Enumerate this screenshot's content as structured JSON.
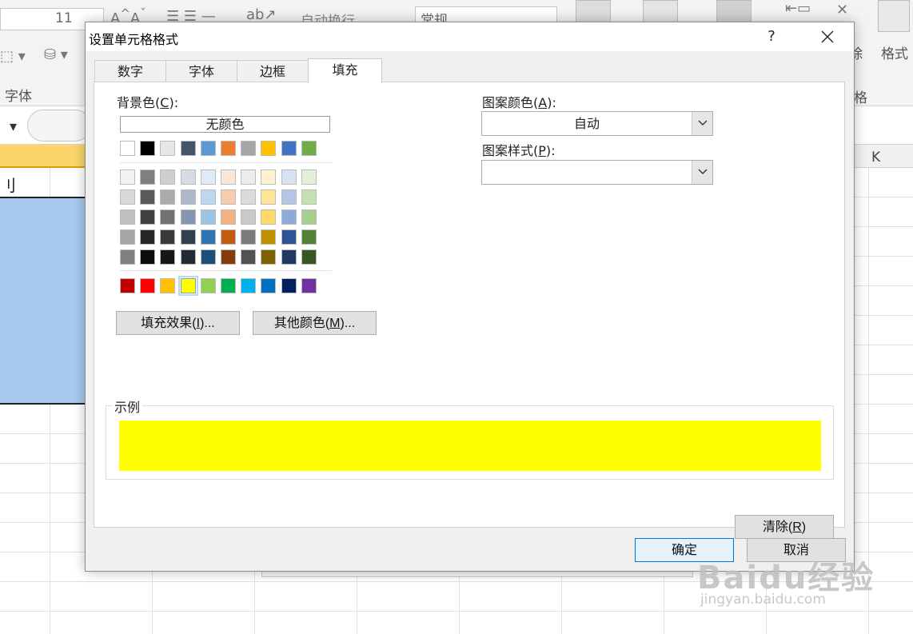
{
  "excel_bg": {
    "font_size": "11",
    "auto_wrap": "自动换行",
    "number_format": "常规",
    "font_group": "字体",
    "cells_group_partial": "格",
    "delete_partial": "除",
    "format": "格式",
    "column_k": "K",
    "row_text": "刂"
  },
  "dialog": {
    "title": "设置单元格格式",
    "help": "?",
    "close": "✕",
    "tabs": [
      {
        "label": "数字"
      },
      {
        "label": "字体"
      },
      {
        "label": "边框"
      },
      {
        "label": "填充",
        "active": true
      }
    ],
    "background_color": {
      "label": "背景色",
      "hotkey": "C",
      "suffix": ":",
      "no_color": "无颜色"
    },
    "top_row": [
      "#ffffff",
      "#000000",
      "#e7e6e6",
      "#44546a",
      "#5b9bd5",
      "#ed7d31",
      "#a5a5a5",
      "#ffc000",
      "#4472c4",
      "#70ad47"
    ],
    "shade_rows": [
      [
        "#f2f2f2",
        "#7f7f7f",
        "#d0cece",
        "#d6dce4",
        "#deebf6",
        "#fbe5d5",
        "#ededed",
        "#fff2cc",
        "#d9e2f3",
        "#e2efd9"
      ],
      [
        "#d8d8d8",
        "#595959",
        "#aeaaaa",
        "#adb9ca",
        "#bdd7ee",
        "#f7cbac",
        "#dbdbdb",
        "#fee599",
        "#b4c6e7",
        "#c5e0b3"
      ],
      [
        "#bfbfbf",
        "#3f3f3f",
        "#757070",
        "#8496b0",
        "#9dc3e6",
        "#f4b183",
        "#c9c9c9",
        "#ffd966",
        "#8eaadb",
        "#a8d08d"
      ],
      [
        "#a5a5a5",
        "#262626",
        "#3a3838",
        "#323f4f",
        "#2e75b5",
        "#c55a11",
        "#7b7b7b",
        "#bf9000",
        "#2f5496",
        "#538135"
      ],
      [
        "#7f7f7f",
        "#0c0c0c",
        "#171616",
        "#222a35",
        "#1e4e79",
        "#843c0b",
        "#525252",
        "#7f6000",
        "#1f3864",
        "#375623"
      ]
    ],
    "standard_row": [
      "#c00000",
      "#ff0000",
      "#ffc000",
      "#ffff00",
      "#92d050",
      "#00b050",
      "#00b0f0",
      "#0070c0",
      "#002060",
      "#7030a0"
    ],
    "selected_standard_index": 3,
    "fill_effects": {
      "label": "填充效果",
      "hotkey": "I",
      "suffix": "..."
    },
    "more_colors": {
      "label": "其他颜色",
      "hotkey": "M",
      "suffix": "..."
    },
    "pattern_color": {
      "label": "图案颜色",
      "hotkey": "A",
      "suffix": ":",
      "value": "自动"
    },
    "pattern_style": {
      "label": "图案样式",
      "hotkey": "P",
      "suffix": ":",
      "value": ""
    },
    "sample": {
      "label": "示例",
      "color": "#ffff00"
    },
    "clear": {
      "label": "清除",
      "hotkey": "R"
    },
    "ok": "确定",
    "cancel": "取消"
  },
  "watermark": {
    "main": "Baidu经验",
    "sub": "jingyan.baidu.com"
  }
}
